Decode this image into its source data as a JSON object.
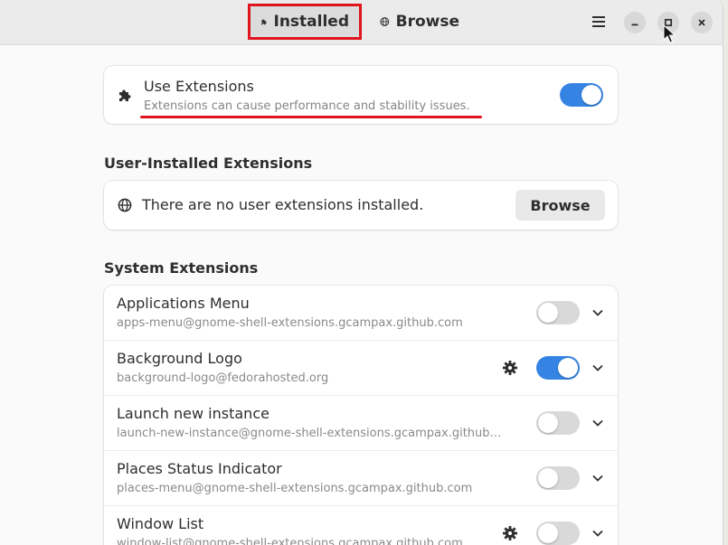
{
  "headerbar": {
    "tabs": [
      {
        "label": "Installed",
        "icon": "puzzle-piece-icon",
        "active": true
      },
      {
        "label": "Browse",
        "icon": "globe-icon",
        "active": false
      }
    ],
    "menu_icon": "hamburger-menu-icon",
    "window_controls": [
      "minimize-icon",
      "maximize-icon",
      "close-icon"
    ]
  },
  "use_extensions": {
    "title": "Use Extensions",
    "subtitle": "Extensions can cause performance and stability issues.",
    "enabled": true
  },
  "user_installed": {
    "heading": "User-Installed Extensions",
    "empty_text": "There are no user extensions installed.",
    "browse_label": "Browse"
  },
  "system": {
    "heading": "System Extensions",
    "extensions": [
      {
        "name": "Applications Menu",
        "uuid": "apps-menu@gnome-shell-extensions.gcampax.github.com",
        "enabled": false,
        "has_settings": false
      },
      {
        "name": "Background Logo",
        "uuid": "background-logo@fedorahosted.org",
        "enabled": true,
        "has_settings": true
      },
      {
        "name": "Launch new instance",
        "uuid": "launch-new-instance@gnome-shell-extensions.gcampax.github…",
        "enabled": false,
        "has_settings": false
      },
      {
        "name": "Places Status Indicator",
        "uuid": "places-menu@gnome-shell-extensions.gcampax.github.com",
        "enabled": false,
        "has_settings": false
      },
      {
        "name": "Window List",
        "uuid": "window-list@gnome-shell-extensions.gcampax.github.com",
        "enabled": false,
        "has_settings": true
      }
    ]
  },
  "colors": {
    "accent": "#3584e4",
    "annotation": "#e0141f"
  }
}
